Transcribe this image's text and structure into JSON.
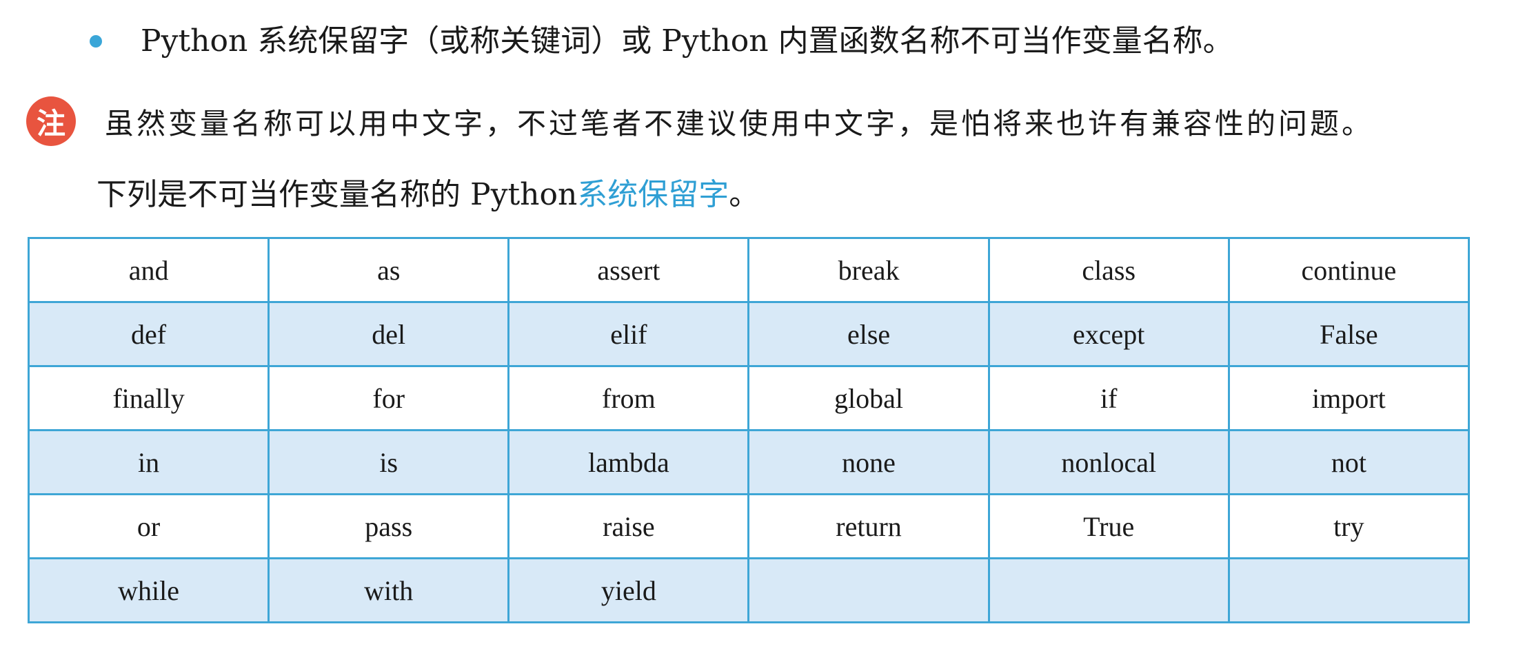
{
  "bullet": {
    "text": "Python 系统保留字（或称关键词）或 Python 内置函数名称不可当作变量名称。"
  },
  "note": {
    "badge": "注",
    "text": "虽然变量名称可以用中文字，不过笔者不建议使用中文字，是怕将来也许有兼容性的问题。"
  },
  "intro": {
    "prefix": "下列是不可当作变量名称的 Python ",
    "highlight": "系统保留字",
    "suffix": "。"
  },
  "colors": {
    "bullet": "#3aa6d8",
    "badge": "#e8543f",
    "highlight": "#2f9fd4",
    "table_border": "#3ea6d6",
    "shaded_row": "#d8e9f7"
  },
  "table": {
    "rows": [
      [
        "and",
        "as",
        "assert",
        "break",
        "class",
        "continue"
      ],
      [
        "def",
        "del",
        "elif",
        "else",
        "except",
        "False"
      ],
      [
        "finally",
        "for",
        "from",
        "global",
        "if",
        "import"
      ],
      [
        "in",
        "is",
        "lambda",
        "none",
        "nonlocal",
        "not"
      ],
      [
        "or",
        "pass",
        "raise",
        "return",
        "True",
        "try"
      ],
      [
        "while",
        "with",
        "yield",
        "",
        "",
        ""
      ]
    ]
  }
}
